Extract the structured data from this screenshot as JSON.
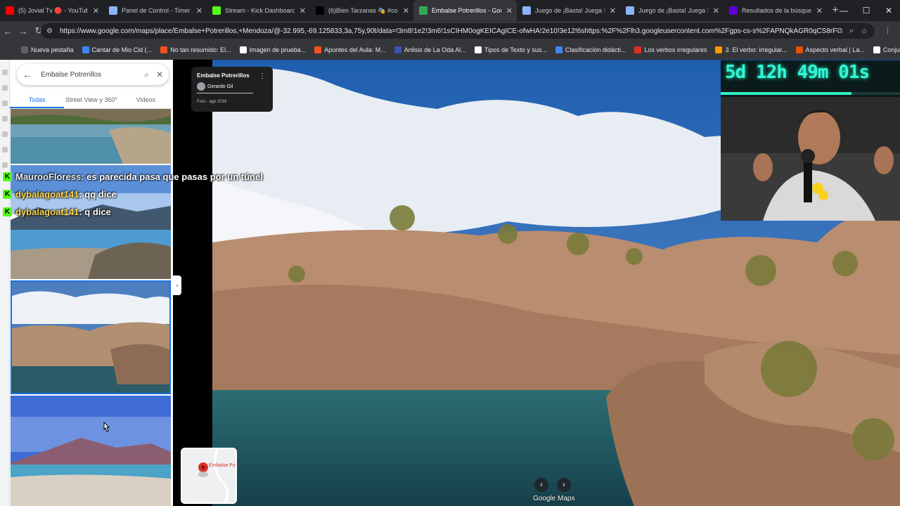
{
  "tabs": [
    {
      "title": "(5) Jovial Tv 🔴 - YouTube",
      "icon": "youtube-icon",
      "color": "#ff0000",
      "active": false
    },
    {
      "title": "Panel de Control - Timer",
      "icon": "timer-icon",
      "color": "#8ab4f8",
      "active": false
    },
    {
      "title": "Stream - Kick Dashboard",
      "icon": "kick-icon",
      "color": "#53fc18",
      "active": false
    },
    {
      "title": "(6)Bien Tarzanas 🎭 #com",
      "icon": "tiktok-icon",
      "color": "#000000",
      "active": false
    },
    {
      "title": "Embalse Potrerillos - Goo",
      "icon": "maps-icon",
      "color": "#34a853",
      "active": true
    },
    {
      "title": "Juego de ¡Basta! Juega St",
      "icon": "globe-icon",
      "color": "#8ab4f8",
      "active": false
    },
    {
      "title": "Juego de ¡Basta! Juega St",
      "icon": "globe-icon",
      "color": "#8ab4f8",
      "active": false
    },
    {
      "title": "Resultados de la búsqued",
      "icon": "yahoo-icon",
      "color": "#6001d2",
      "active": false
    }
  ],
  "address": "https://www.google.com/maps/place/Embalse+Potrerillos,+Mendoza/@-32.995,-69.125833,3a,75y,90t/data=!3m8!1e2!3m6!1sCIHM0ogKEICAgICE-ofwHA!2e10!3e12!6shttps:%2F%2Flh3.googleusercontent.com%2Fgps-cs-s%2FAPNQkAGR0qCS8rF-...",
  "bookmarks": [
    {
      "label": "Nueva pestaña",
      "color": "#5f6368"
    },
    {
      "label": "Cantar de Mio Cid (...",
      "color": "#4285f4"
    },
    {
      "label": "No tan resumido: El...",
      "color": "#f4511e"
    },
    {
      "label": "Imagen de prueba...",
      "color": "#ffffff"
    },
    {
      "label": "Apuntes del Aula: M...",
      "color": "#f4511e"
    },
    {
      "label": "Anlisis de La Oda Al...",
      "color": "#3f51b5"
    },
    {
      "label": "Tipos de Texto y sus...",
      "color": "#ffffff"
    },
    {
      "label": "Clasificación didácti...",
      "color": "#4285f4"
    },
    {
      "label": "Los verbos irregulares",
      "color": "#d93025"
    },
    {
      "label": "3. El verbo: irregular...",
      "color": "#ff9800"
    },
    {
      "label": "Aspecto verbal | La...",
      "color": "#e65100"
    },
    {
      "label": "Conjugación dar | C...",
      "color": "#ffffff"
    }
  ],
  "search": {
    "query": "Embalse Potrerillos"
  },
  "panel_tabs": [
    "Todas",
    "Street View y 360°",
    "Videos"
  ],
  "photo_card": {
    "title": "Embalse Potrerillos",
    "author": "Gerardo Gil",
    "date": "Foto - ago 2016"
  },
  "minimap": {
    "label": "Embalse Po"
  },
  "footer": {
    "brand": "Google Maps"
  },
  "chat": [
    {
      "user": "MaurooFloress",
      "message": " : es parecida pasa que pasas por un túnel"
    },
    {
      "user": "dybalagoat141",
      "message": " : qq dice"
    },
    {
      "user": "dybalagoat141",
      "message": " : q dice"
    }
  ],
  "timer": {
    "text": "5d 12h 49m 01s",
    "progress": 0.73
  }
}
